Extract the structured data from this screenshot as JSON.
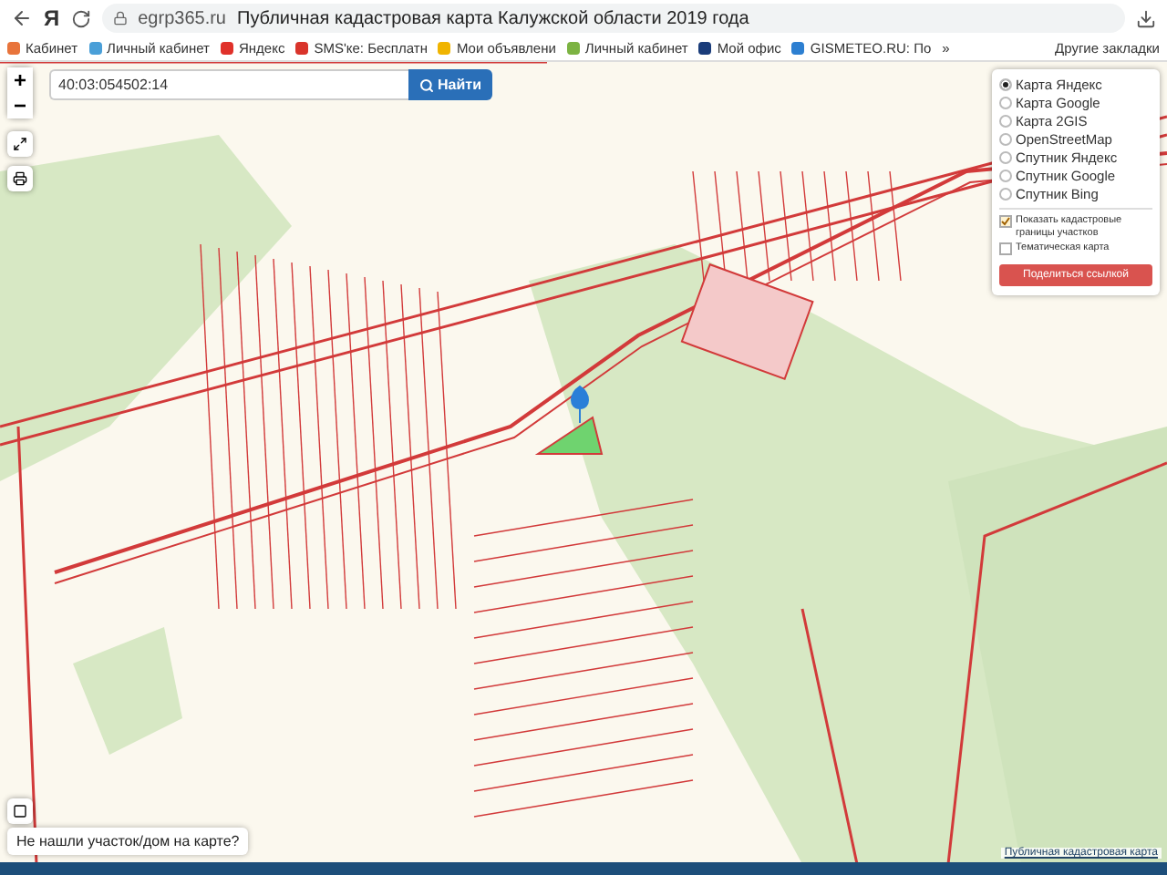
{
  "browser": {
    "logo": "Я",
    "url": "egrp365.ru",
    "page_title": "Публичная кадастровая карта Калужской области 2019 года",
    "bookmarks": [
      {
        "label": "Кабинет",
        "color": "#e8743b"
      },
      {
        "label": "Личный кабинет",
        "color": "#4a9fd8"
      },
      {
        "label": "Яндекс",
        "color": "#e0312a"
      },
      {
        "label": "SMS'ке: Бесплатн",
        "color": "#d9342b"
      },
      {
        "label": "Мои объявлени",
        "color": "#f0b400"
      },
      {
        "label": "Личный кабинет",
        "color": "#7cb342"
      },
      {
        "label": "Мой офис",
        "color": "#1a3c7a"
      },
      {
        "label": "GISMETEO.RU: По",
        "color": "#2d7fd1"
      }
    ],
    "more": "»",
    "other_bookmarks": "Другие закладки"
  },
  "map": {
    "zoom_in": "+",
    "zoom_out": "−",
    "search": {
      "value": "40:03:054502:14",
      "button": "Найти"
    },
    "layers": [
      {
        "label": "Карта Яндекс",
        "selected": true
      },
      {
        "label": "Карта Google",
        "selected": false
      },
      {
        "label": "Карта 2GIS",
        "selected": false
      },
      {
        "label": "OpenStreetMap",
        "selected": false
      },
      {
        "label": "Спутник Яндекс",
        "selected": false
      },
      {
        "label": "Спутник Google",
        "selected": false
      },
      {
        "label": "Спутник Bing",
        "selected": false
      }
    ],
    "options": [
      {
        "label": "Показать кадастровые границы участков",
        "checked": true
      },
      {
        "label": "Тематическая карта",
        "checked": false
      }
    ],
    "share_button": "Поделиться ссылкой",
    "not_found": "Не нашли участок/дом на карте?",
    "attribution": "Публичная кадастровая карта"
  }
}
